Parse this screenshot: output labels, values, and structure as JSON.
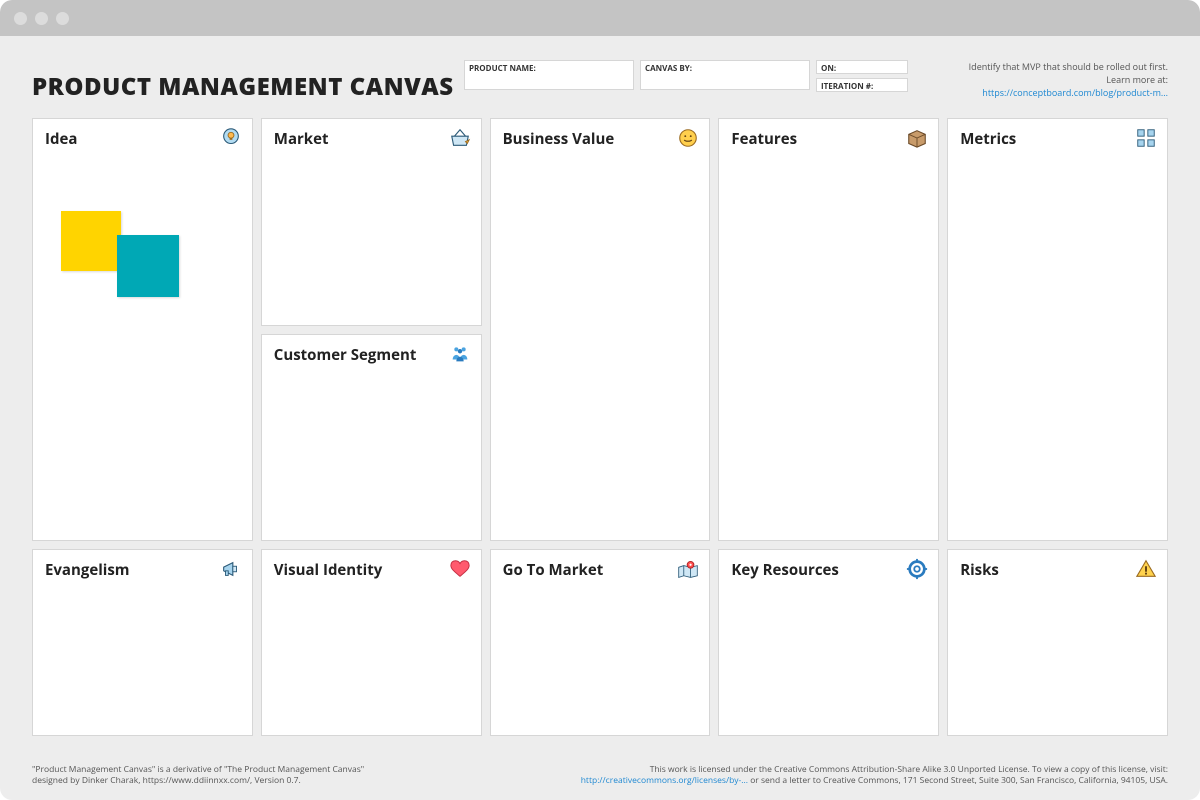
{
  "title": "PRODUCT MANAGEMENT CANVAS",
  "meta": {
    "product_name_label": "PRODUCT NAME:",
    "canvas_by_label": "CANVAS BY:",
    "on_label": "ON:",
    "iteration_label": "ITERATION #:"
  },
  "hint": {
    "line1": "Identify that MVP that should be rolled out first.",
    "line2_prefix": "Learn more at: ",
    "link_text": "https://conceptboard.com/blog/product-m..."
  },
  "cards": {
    "idea": "Idea",
    "market": "Market",
    "segment": "Customer Segment",
    "bizval": "Business Value",
    "features": "Features",
    "metrics": "Metrics",
    "evangelism": "Evangelism",
    "visualid": "Visual Identity",
    "gotomarket": "Go To Market",
    "keyres": "Key Resources",
    "risks": "Risks"
  },
  "footer": {
    "left_line1": "\"Product Management Canvas\" is a derivative of \"The Product Management Canvas\"",
    "left_line2": "designed by Dinker Charak, https://www.ddiinnxx.com/, Version 0.7.",
    "right_prefix": "This work is licensed under the Creative Commons Attribution-Share Alike 3.0 Unported License. To view a copy of this license, visit:",
    "right_link": "http://creativecommons.org/licenses/by-...",
    "right_suffix": " or send a letter to Creative Commons, 171 Second Street, Suite 300, San Francisco, California, 94105, USA."
  }
}
